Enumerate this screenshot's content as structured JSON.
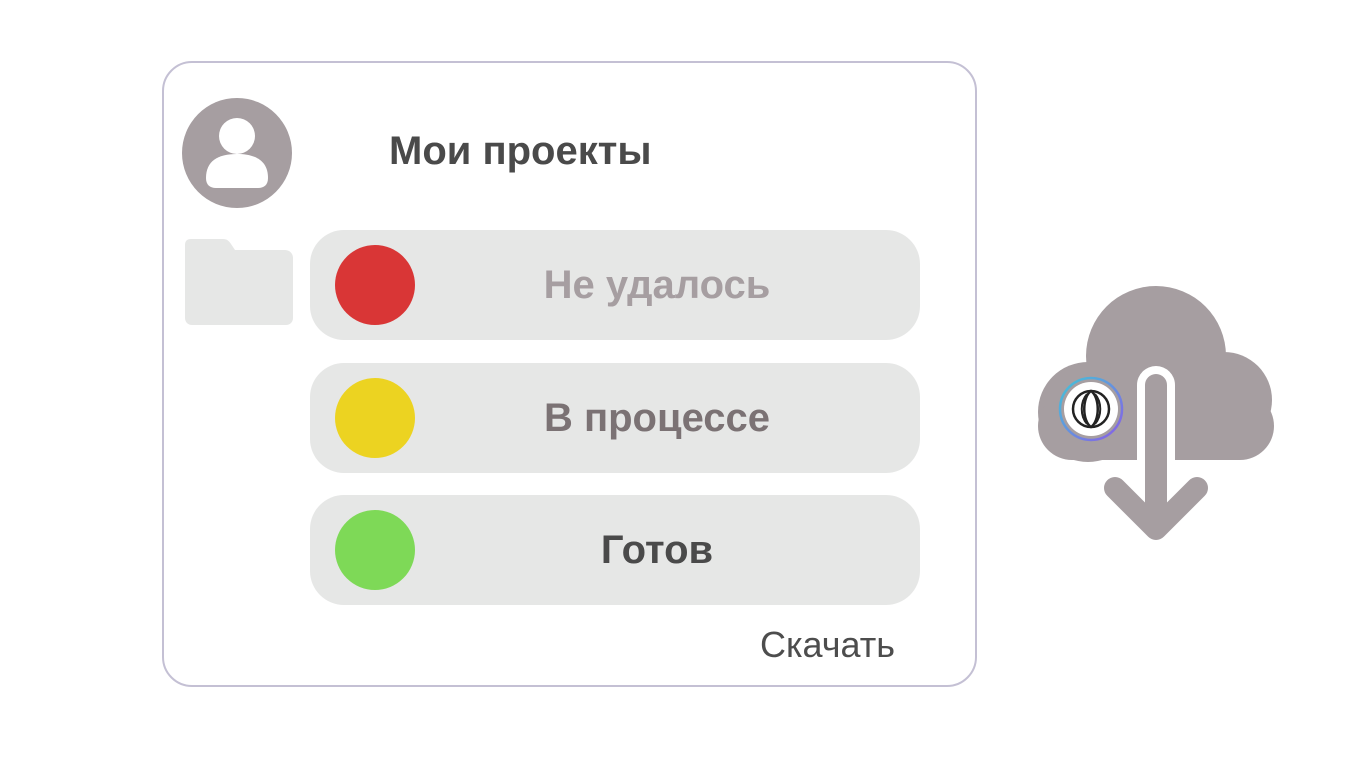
{
  "header": {
    "title": "Мои проекты"
  },
  "status_items": [
    {
      "label": "Не удалось",
      "dot_color": "#d93636",
      "text_color": "#a69ea1",
      "status": "failed"
    },
    {
      "label": "В процессе",
      "dot_color": "#ecd321",
      "text_color": "#7b7274",
      "status": "in-progress"
    },
    {
      "label": "Готов",
      "dot_color": "#7ed957",
      "text_color": "#4a4a4a",
      "status": "done"
    }
  ],
  "footer": {
    "download_label": "Скачать"
  },
  "colors": {
    "panel_border": "#c4c0d4",
    "row_background": "#e6e7e6",
    "icon_gray": "#a69ea1",
    "folder_gray": "#e6e7e6",
    "title_text": "#4a4a4a"
  },
  "icons": {
    "avatar": "user-icon",
    "folder": "folder-icon",
    "cloud": "cloud-download-icon",
    "badge": "app-badge-icon"
  }
}
